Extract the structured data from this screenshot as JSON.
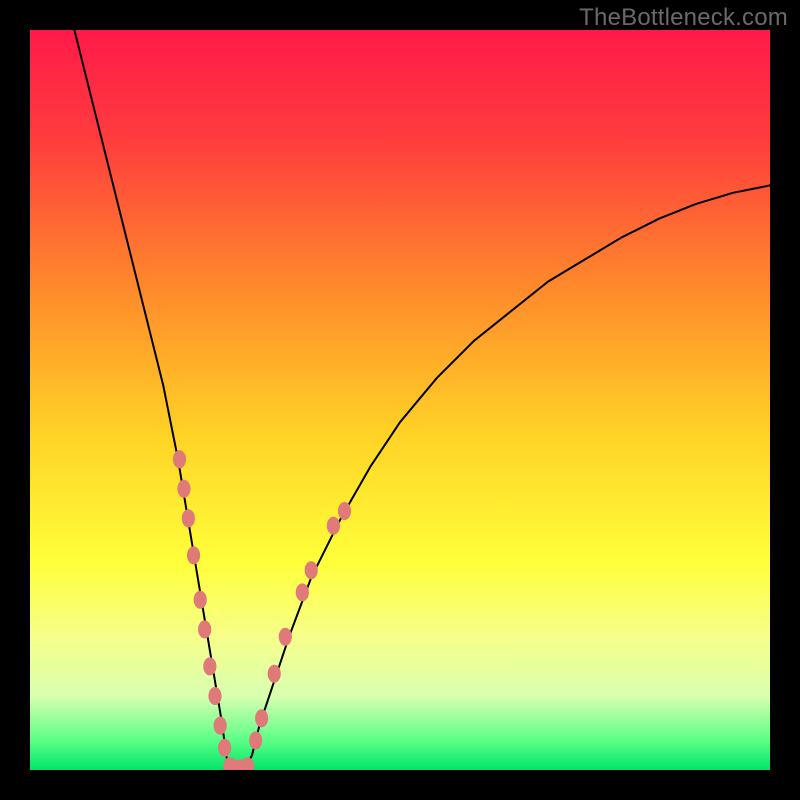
{
  "watermark": "TheBottleneck.com",
  "chart_data": {
    "type": "line",
    "title": "",
    "xlabel": "",
    "ylabel": "",
    "xlim": [
      0,
      100
    ],
    "ylim": [
      0,
      100
    ],
    "background_gradient": {
      "stops": [
        {
          "offset": 0.0,
          "color": "#ff1a4a"
        },
        {
          "offset": 0.15,
          "color": "#ff3d3d"
        },
        {
          "offset": 0.35,
          "color": "#ff8a2b"
        },
        {
          "offset": 0.55,
          "color": "#ffd426"
        },
        {
          "offset": 0.72,
          "color": "#ffff3a"
        },
        {
          "offset": 0.82,
          "color": "#f7ff8a"
        },
        {
          "offset": 0.9,
          "color": "#d8ffb0"
        },
        {
          "offset": 0.96,
          "color": "#5cff86"
        },
        {
          "offset": 1.0,
          "color": "#00e66a"
        }
      ]
    },
    "series": [
      {
        "name": "bottleneck-curve",
        "color": "#000000",
        "stroke_width": 2,
        "x": [
          6,
          8,
          10,
          12,
          14,
          16,
          18,
          20,
          21,
          22,
          23,
          24,
          25,
          26,
          26.5,
          27,
          28,
          29,
          30,
          31,
          33,
          35,
          38,
          42,
          46,
          50,
          55,
          60,
          65,
          70,
          75,
          80,
          85,
          90,
          95,
          100
        ],
        "y": [
          100,
          92,
          84,
          76,
          68,
          60,
          52,
          42,
          36,
          30,
          24,
          18,
          12,
          6,
          2,
          0,
          0,
          0,
          2,
          6,
          12,
          18,
          26,
          34,
          41,
          47,
          53,
          58,
          62,
          66,
          69,
          72,
          74.5,
          76.5,
          78,
          79
        ]
      }
    ],
    "marker_clusters": [
      {
        "name": "left-arm-markers",
        "color": "#e07a78",
        "size": 12,
        "points": [
          {
            "x": 20.2,
            "y": 42
          },
          {
            "x": 20.8,
            "y": 38
          },
          {
            "x": 21.4,
            "y": 34
          },
          {
            "x": 22.1,
            "y": 29
          },
          {
            "x": 23.0,
            "y": 23
          },
          {
            "x": 23.6,
            "y": 19
          },
          {
            "x": 24.3,
            "y": 14
          },
          {
            "x": 25.0,
            "y": 10
          },
          {
            "x": 25.7,
            "y": 6
          },
          {
            "x": 26.3,
            "y": 3
          }
        ]
      },
      {
        "name": "bottom-markers",
        "color": "#e07a78",
        "size": 12,
        "points": [
          {
            "x": 27.0,
            "y": 0.5
          },
          {
            "x": 27.8,
            "y": 0.2
          },
          {
            "x": 28.6,
            "y": 0.2
          },
          {
            "x": 29.4,
            "y": 0.5
          }
        ]
      },
      {
        "name": "right-arm-markers",
        "color": "#e07a78",
        "size": 12,
        "points": [
          {
            "x": 30.5,
            "y": 4
          },
          {
            "x": 31.3,
            "y": 7
          },
          {
            "x": 33.0,
            "y": 13
          },
          {
            "x": 34.5,
            "y": 18
          },
          {
            "x": 36.8,
            "y": 24
          },
          {
            "x": 38.0,
            "y": 27
          },
          {
            "x": 41.0,
            "y": 33
          },
          {
            "x": 42.5,
            "y": 35
          }
        ]
      }
    ]
  }
}
